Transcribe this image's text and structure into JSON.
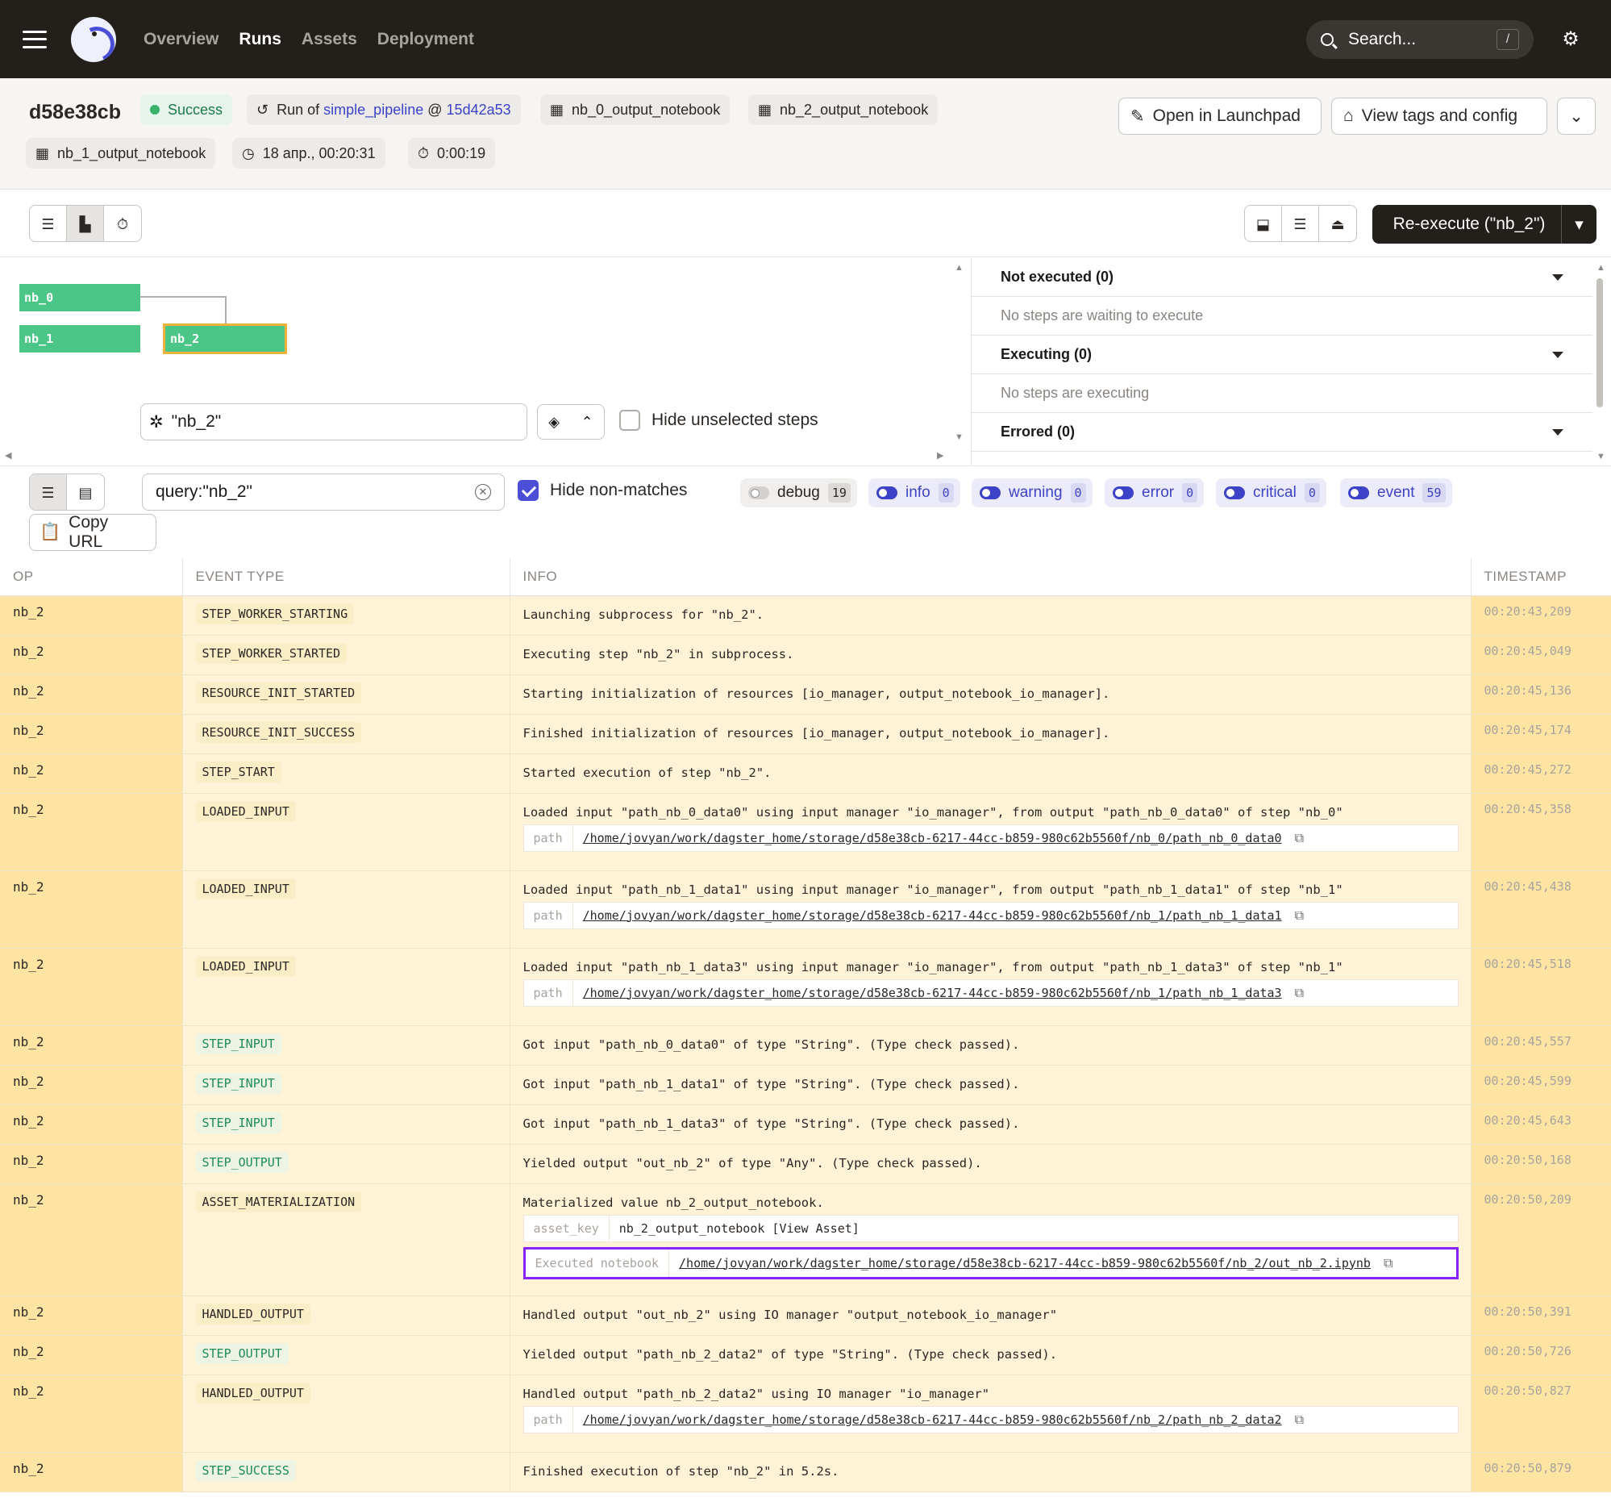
{
  "nav": {
    "items": [
      "Overview",
      "Runs",
      "Assets",
      "Deployment"
    ],
    "active": "Runs"
  },
  "search": {
    "placeholder": "Search...",
    "shortcut": "/"
  },
  "run": {
    "id": "d58e38cb",
    "status": "Success",
    "run_of_prefix": "Run of",
    "pipeline": "simple_pipeline",
    "at": "@",
    "snapshot": "15d42a53",
    "assets": [
      "nb_0_output_notebook",
      "nb_2_output_notebook",
      "nb_1_output_notebook"
    ],
    "started": "18 апр., 00:20:31",
    "duration": "0:00:19"
  },
  "actions": {
    "launchpad": "Open in Launchpad",
    "tags": "View tags and config",
    "reexecute": "Re-execute (\"nb_2\")"
  },
  "gantt": {
    "nodes": [
      "nb_0",
      "nb_1",
      "nb_2"
    ],
    "selection_query": "\"nb_2\"",
    "hide_unselected": "Hide unselected steps"
  },
  "side_panel": {
    "sections": [
      {
        "title": "Not executed (0)",
        "empty": "No steps are waiting to execute"
      },
      {
        "title": "Executing (0)",
        "empty": "No steps are executing"
      },
      {
        "title": "Errored (0)",
        "empty": ""
      }
    ]
  },
  "logs": {
    "query": "query:\"nb_2\"",
    "hide_non_matches": "Hide non-matches",
    "copy_url": "Copy URL",
    "levels": [
      {
        "name": "debug",
        "count": "19",
        "enabled": false
      },
      {
        "name": "info",
        "count": "0",
        "enabled": true
      },
      {
        "name": "warning",
        "count": "0",
        "enabled": true
      },
      {
        "name": "error",
        "count": "0",
        "enabled": true
      },
      {
        "name": "critical",
        "count": "0",
        "enabled": true
      },
      {
        "name": "event",
        "count": "59",
        "enabled": true
      }
    ],
    "columns": [
      "OP",
      "EVENT TYPE",
      "INFO",
      "TIMESTAMP"
    ],
    "rows": [
      {
        "op": "nb_2",
        "type": "STEP_WORKER_STARTING",
        "green": false,
        "info": "Launching subprocess for \"nb_2\".",
        "ts": "00:20:43,209"
      },
      {
        "op": "nb_2",
        "type": "STEP_WORKER_STARTED",
        "green": false,
        "info": "Executing step \"nb_2\" in subprocess.",
        "ts": "00:20:45,049"
      },
      {
        "op": "nb_2",
        "type": "RESOURCE_INIT_STARTED",
        "green": false,
        "info": "Starting initialization of resources [io_manager, output_notebook_io_manager].",
        "ts": "00:20:45,136"
      },
      {
        "op": "nb_2",
        "type": "RESOURCE_INIT_SUCCESS",
        "green": false,
        "info": "Finished initialization of resources [io_manager, output_notebook_io_manager].",
        "ts": "00:20:45,174"
      },
      {
        "op": "nb_2",
        "type": "STEP_START",
        "green": false,
        "info": "Started execution of step \"nb_2\".",
        "ts": "00:20:45,272"
      },
      {
        "op": "nb_2",
        "type": "LOADED_INPUT",
        "green": false,
        "info": "Loaded input \"path_nb_0_data0\" using input manager \"io_manager\", from output \"path_nb_0_data0\" of step \"nb_0\"",
        "ts": "00:20:45,358",
        "kv": [
          {
            "k": "path",
            "v": "/home/jovyan/work/dagster_home/storage/d58e38cb-6217-44cc-b859-980c62b5560f/nb_0/path_nb_0_data0",
            "link": true
          }
        ]
      },
      {
        "op": "nb_2",
        "type": "LOADED_INPUT",
        "green": false,
        "info": "Loaded input \"path_nb_1_data1\" using input manager \"io_manager\", from output \"path_nb_1_data1\" of step \"nb_1\"",
        "ts": "00:20:45,438",
        "kv": [
          {
            "k": "path",
            "v": "/home/jovyan/work/dagster_home/storage/d58e38cb-6217-44cc-b859-980c62b5560f/nb_1/path_nb_1_data1",
            "link": true
          }
        ]
      },
      {
        "op": "nb_2",
        "type": "LOADED_INPUT",
        "green": false,
        "info": "Loaded input \"path_nb_1_data3\" using input manager \"io_manager\", from output \"path_nb_1_data3\" of step \"nb_1\"",
        "ts": "00:20:45,518",
        "kv": [
          {
            "k": "path",
            "v": "/home/jovyan/work/dagster_home/storage/d58e38cb-6217-44cc-b859-980c62b5560f/nb_1/path_nb_1_data3",
            "link": true
          }
        ]
      },
      {
        "op": "nb_2",
        "type": "STEP_INPUT",
        "green": true,
        "info": "Got input \"path_nb_0_data0\" of type \"String\". (Type check passed).",
        "ts": "00:20:45,557"
      },
      {
        "op": "nb_2",
        "type": "STEP_INPUT",
        "green": true,
        "info": "Got input \"path_nb_1_data1\" of type \"String\". (Type check passed).",
        "ts": "00:20:45,599"
      },
      {
        "op": "nb_2",
        "type": "STEP_INPUT",
        "green": true,
        "info": "Got input \"path_nb_1_data3\" of type \"String\". (Type check passed).",
        "ts": "00:20:45,643"
      },
      {
        "op": "nb_2",
        "type": "STEP_OUTPUT",
        "green": true,
        "info": "Yielded output \"out_nb_2\" of type \"Any\". (Type check passed).",
        "ts": "00:20:50,168"
      },
      {
        "op": "nb_2",
        "type": "ASSET_MATERIALIZATION",
        "green": false,
        "info": "Materialized value nb_2_output_notebook.",
        "ts": "00:20:50,209",
        "kv": [
          {
            "k": "asset_key",
            "v": "nb_2_output_notebook  [View Asset]",
            "link": false
          },
          {
            "k": "Executed notebook",
            "v": "/home/jovyan/work/dagster_home/storage/d58e38cb-6217-44cc-b859-980c62b5560f/nb_2/out_nb_2.ipynb",
            "link": true,
            "highlight": true
          }
        ]
      },
      {
        "op": "nb_2",
        "type": "HANDLED_OUTPUT",
        "green": false,
        "info": "Handled output \"out_nb_2\" using IO manager \"output_notebook_io_manager\"",
        "ts": "00:20:50,391"
      },
      {
        "op": "nb_2",
        "type": "STEP_OUTPUT",
        "green": true,
        "info": "Yielded output \"path_nb_2_data2\" of type \"String\". (Type check passed).",
        "ts": "00:20:50,726"
      },
      {
        "op": "nb_2",
        "type": "HANDLED_OUTPUT",
        "green": false,
        "info": "Handled output \"path_nb_2_data2\" using IO manager \"io_manager\"",
        "ts": "00:20:50,827",
        "kv": [
          {
            "k": "path",
            "v": "/home/jovyan/work/dagster_home/storage/d58e38cb-6217-44cc-b859-980c62b5560f/nb_2/path_nb_2_data2",
            "link": true
          }
        ]
      },
      {
        "op": "nb_2",
        "type": "STEP_SUCCESS",
        "green": true,
        "info": "Finished execution of step \"nb_2\" in 5.2s.",
        "ts": "00:20:50,879"
      }
    ]
  },
  "colors": {
    "accent": "#4a4fd6",
    "success": "#4cc687",
    "highlight": "#8a22ff",
    "row_bg": "#fef3d6",
    "op_bg": "#fde4a3"
  }
}
